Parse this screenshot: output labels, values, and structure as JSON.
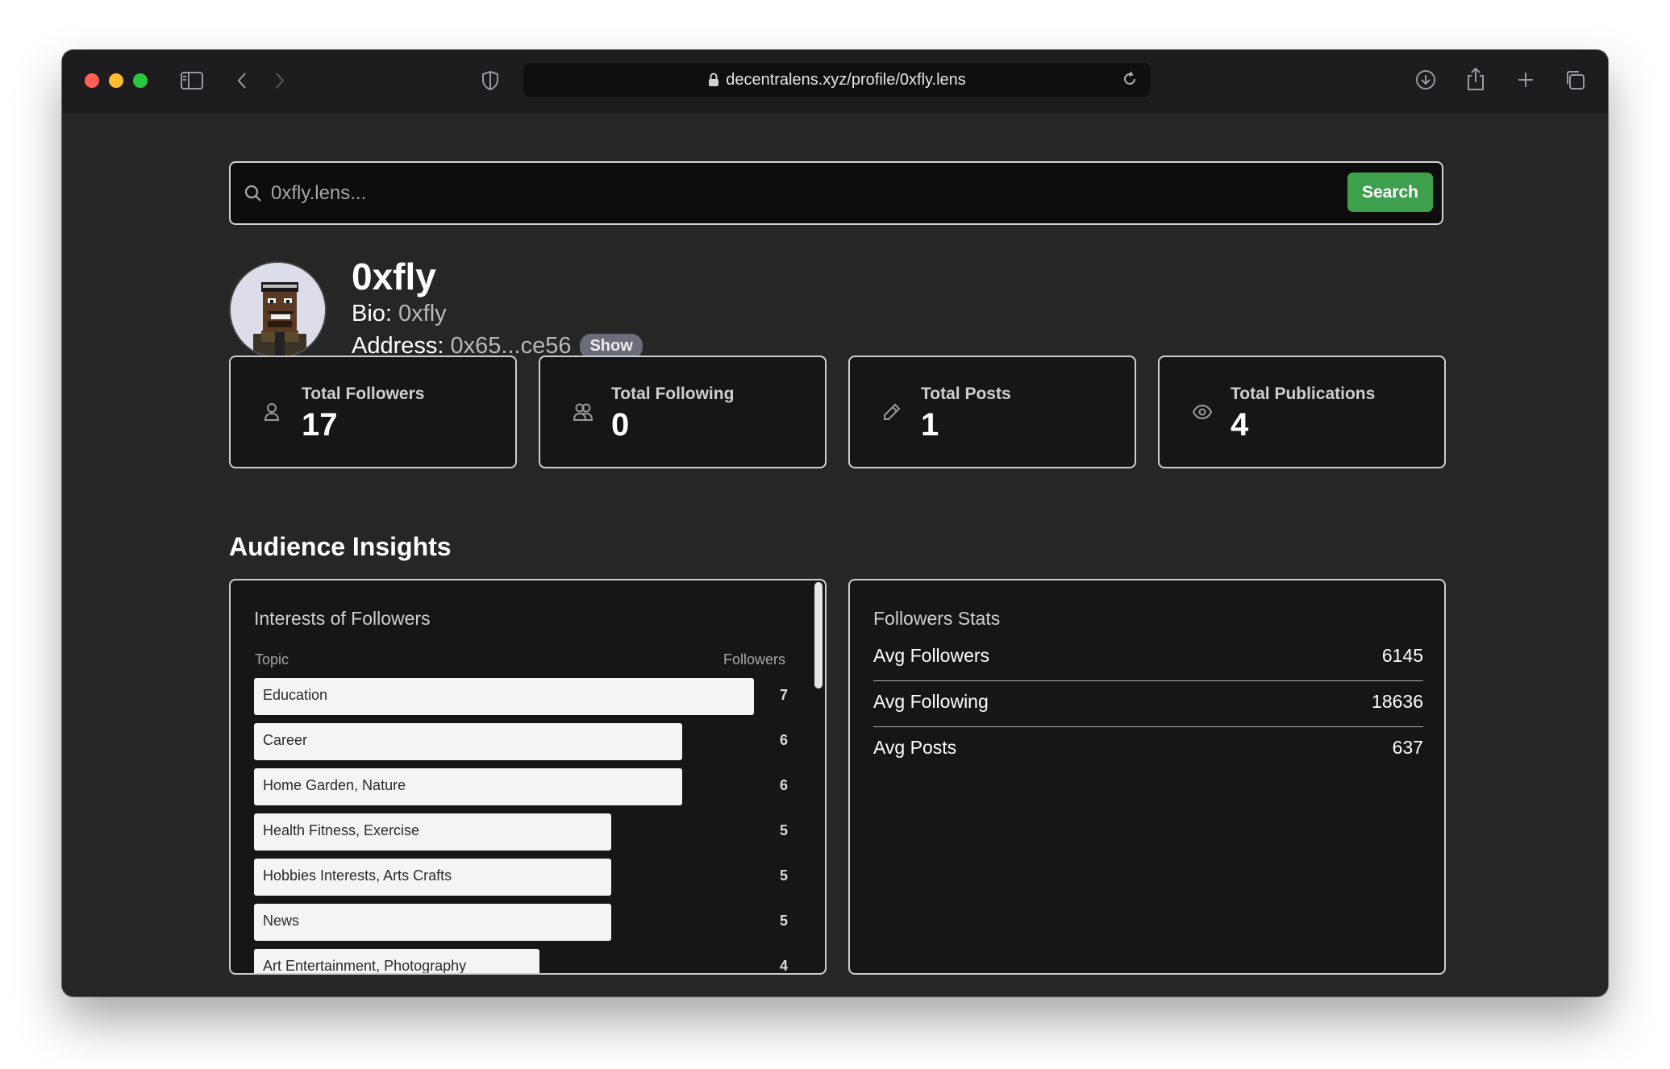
{
  "browser": {
    "url": "decentralens.xyz/profile/0xfly.lens"
  },
  "search": {
    "placeholder": "0xfly.lens...",
    "button_label": "Search"
  },
  "profile": {
    "name": "0xfly",
    "bio_label": "Bio:",
    "bio_value": "0xfly",
    "address_label": "Address:",
    "address_value": "0x65...ce56",
    "show_label": "Show"
  },
  "stats": [
    {
      "label": "Total Followers",
      "value": "17",
      "icon": "user-icon"
    },
    {
      "label": "Total Following",
      "value": "0",
      "icon": "users-icon"
    },
    {
      "label": "Total Posts",
      "value": "1",
      "icon": "pencil-icon"
    },
    {
      "label": "Total Publications",
      "value": "4",
      "icon": "eye-icon"
    }
  ],
  "insights": {
    "title": "Audience Insights",
    "interests": {
      "title": "Interests of Followers",
      "col_topic": "Topic",
      "col_followers": "Followers",
      "rows": [
        {
          "topic": "Education",
          "count": 7
        },
        {
          "topic": "Career",
          "count": 6
        },
        {
          "topic": "Home Garden, Nature",
          "count": 6
        },
        {
          "topic": "Health Fitness, Exercise",
          "count": 5
        },
        {
          "topic": "Hobbies Interests, Arts Crafts",
          "count": 5
        },
        {
          "topic": "News",
          "count": 5
        },
        {
          "topic": "Art Entertainment, Photography",
          "count": 4
        }
      ]
    },
    "followers_stats": {
      "title": "Followers Stats",
      "rows": [
        {
          "label": "Avg Followers",
          "value": "6145"
        },
        {
          "label": "Avg Following",
          "value": "18636"
        },
        {
          "label": "Avg Posts",
          "value": "637"
        }
      ]
    }
  },
  "colors": {
    "accent_green": "#3ea04d",
    "background": "#262626",
    "card": "#161616"
  }
}
